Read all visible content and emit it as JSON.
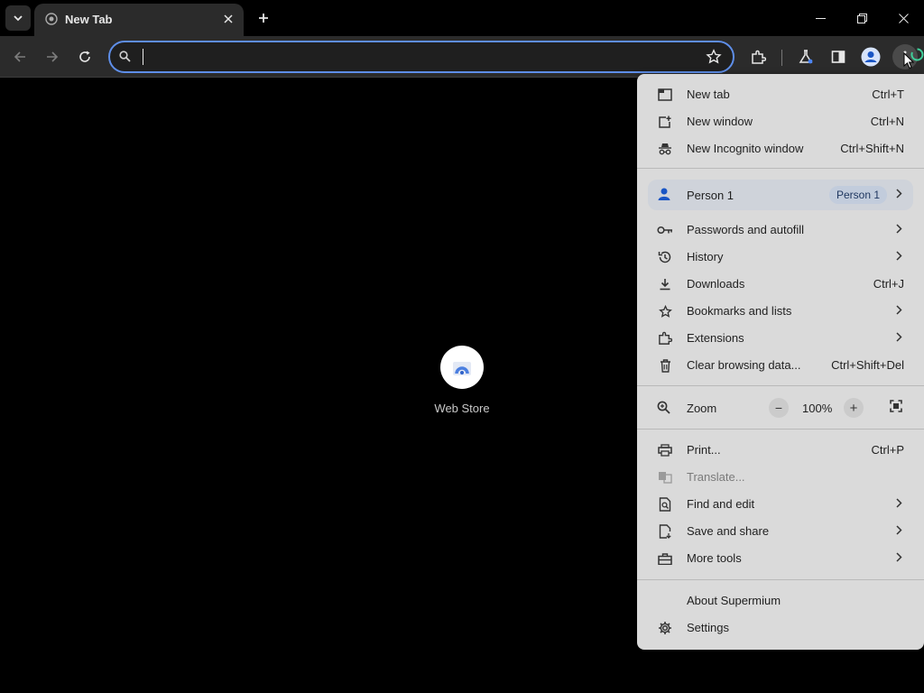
{
  "tab": {
    "title": "New Tab"
  },
  "omnibox": {
    "value": ""
  },
  "content": {
    "shortcut_label": "Web Store"
  },
  "menu": {
    "group1": [
      {
        "label": "New tab",
        "shortcut": "Ctrl+T"
      },
      {
        "label": "New window",
        "shortcut": "Ctrl+N"
      },
      {
        "label": "New Incognito window",
        "shortcut": "Ctrl+Shift+N"
      }
    ],
    "profile": {
      "label": "Person 1",
      "badge": "Person 1"
    },
    "group2": [
      {
        "label": "Passwords and autofill",
        "shortcut": ""
      },
      {
        "label": "History",
        "shortcut": ""
      },
      {
        "label": "Downloads",
        "shortcut": "Ctrl+J"
      },
      {
        "label": "Bookmarks and lists",
        "shortcut": ""
      },
      {
        "label": "Extensions",
        "shortcut": ""
      },
      {
        "label": "Clear browsing data...",
        "shortcut": "Ctrl+Shift+Del"
      }
    ],
    "zoom": {
      "label": "Zoom",
      "minus": "−",
      "value": "100%",
      "plus": "+"
    },
    "group3": [
      {
        "label": "Print...",
        "shortcut": "Ctrl+P"
      },
      {
        "label": "Translate...",
        "shortcut": ""
      },
      {
        "label": "Find and edit",
        "shortcut": ""
      },
      {
        "label": "Save and share",
        "shortcut": ""
      },
      {
        "label": "More tools",
        "shortcut": ""
      }
    ],
    "group4": [
      {
        "label": "About Supermium"
      },
      {
        "label": "Settings"
      }
    ]
  }
}
